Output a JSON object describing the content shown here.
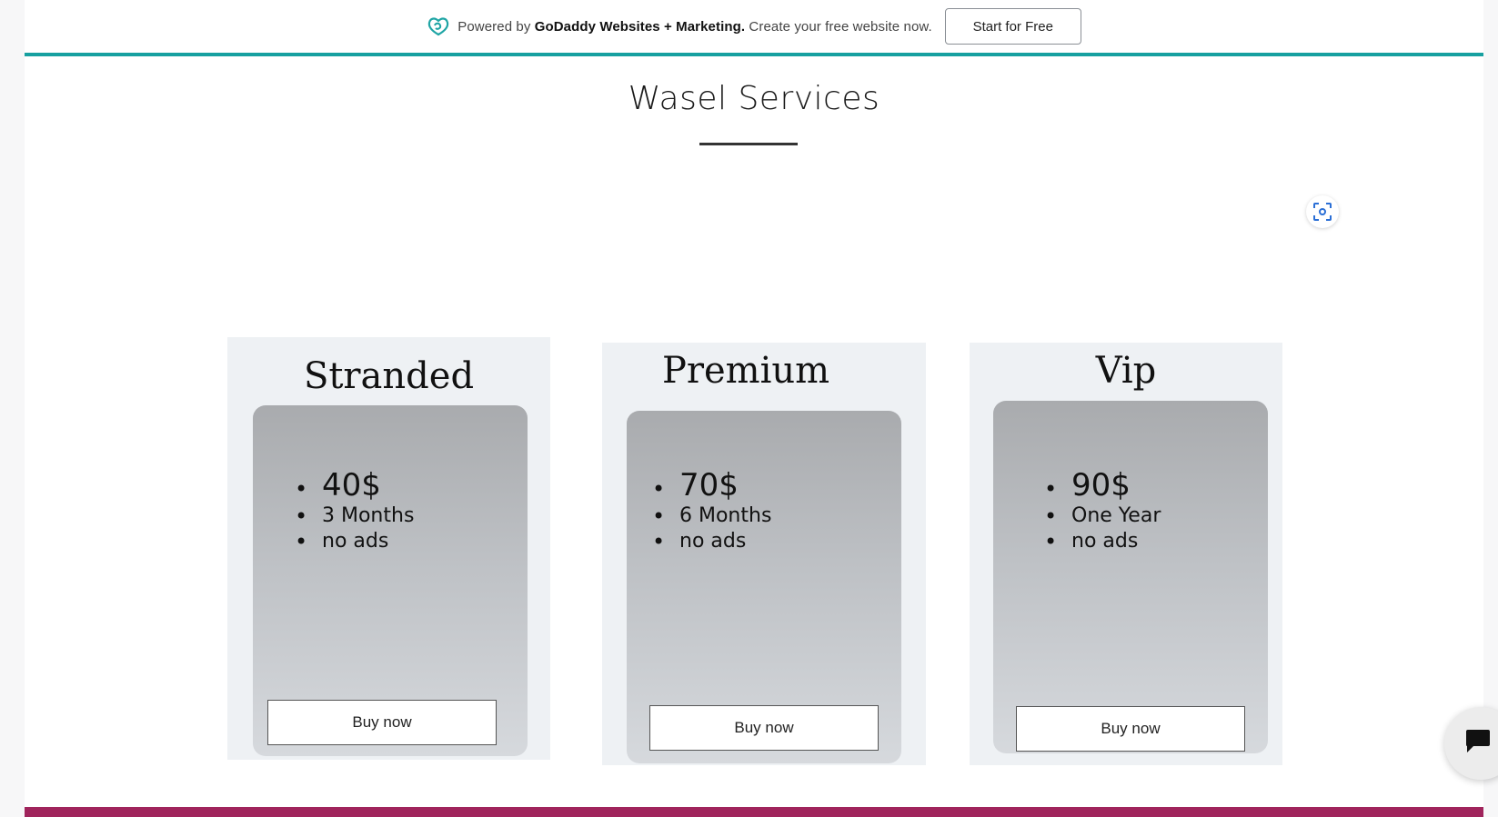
{
  "promo": {
    "prefix": "Powered by ",
    "brand": "GoDaddy Websites + Marketing.",
    "suffix": " Create your free website now.",
    "button_label": "Start for Free"
  },
  "section": {
    "title": "Wasel Services"
  },
  "plans": [
    {
      "name": "Stranded",
      "price": "40$",
      "duration": "3 Months",
      "feature": "no ads",
      "button": "Buy now"
    },
    {
      "name": "Premium",
      "price": "70$",
      "duration": "6 Months",
      "feature": "no ads",
      "button": "Buy now"
    },
    {
      "name": "Vip",
      "price": "90$",
      "duration": "One Year",
      "feature": "no ads",
      "button": "Buy now"
    }
  ],
  "icons": {
    "promo_logo": "godaddy-logo-icon",
    "focus": "focus-view-icon",
    "chat": "chat-icon"
  },
  "colors": {
    "accent_teal": "#17a0a0",
    "footer_magenta": "#a0245c",
    "panel_bg": "#eef1f4",
    "card_gradient_top": "#a9abae",
    "card_gradient_bottom": "#d6d9dd"
  }
}
